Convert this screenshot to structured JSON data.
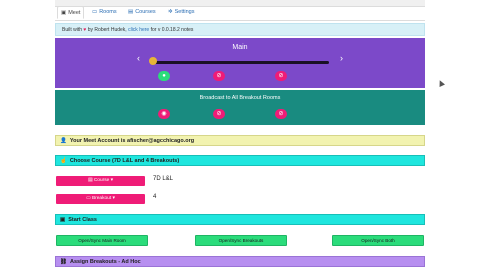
{
  "nav": {
    "tabs": [
      {
        "label": "Meet",
        "icon": "meet-icon"
      },
      {
        "label": "Rooms",
        "icon": "rooms-icon"
      },
      {
        "label": "Courses",
        "icon": "courses-icon"
      },
      {
        "label": "Settings",
        "icon": "gear-icon"
      }
    ],
    "active_index": 0
  },
  "banner": {
    "prefix": "Built with",
    "suffix": "by Robert Hudek,",
    "link": "click here",
    "tail": "for v 0.0.18.2 notes"
  },
  "main_room": {
    "title": "Main",
    "slider_level": 0.0,
    "buttons": [
      "microphone-icon",
      "mic-off-icon",
      "video-off-icon"
    ]
  },
  "broadcast": {
    "title": "Broadcast to All Breakout Rooms",
    "buttons": [
      "speaker-icon",
      "mic-off-icon",
      "video-off-icon"
    ]
  },
  "account": {
    "label": "Your Meet Account is afischer@agcchicago.org"
  },
  "choose_course": {
    "label": "Choose Course (7D L&L and 4 Breakouts)",
    "course_button": "Course",
    "course_value": "7D L&L",
    "breakout_button": "Breakout",
    "breakout_value": "4"
  },
  "start_class": {
    "label": "Start Class",
    "buttons": [
      "Open/Sync Main Room",
      "Open/Sync Breakouts",
      "Open/Sync Both"
    ]
  },
  "assign": {
    "label": "Assign Breakouts - Ad Hoc"
  },
  "colors": {
    "main": "#7c49c9",
    "broadcast": "#198b80",
    "account": "#f2f3b0",
    "choose": "#1fe6de",
    "pink": "#ef1c77",
    "green": "#2bdc7b"
  }
}
